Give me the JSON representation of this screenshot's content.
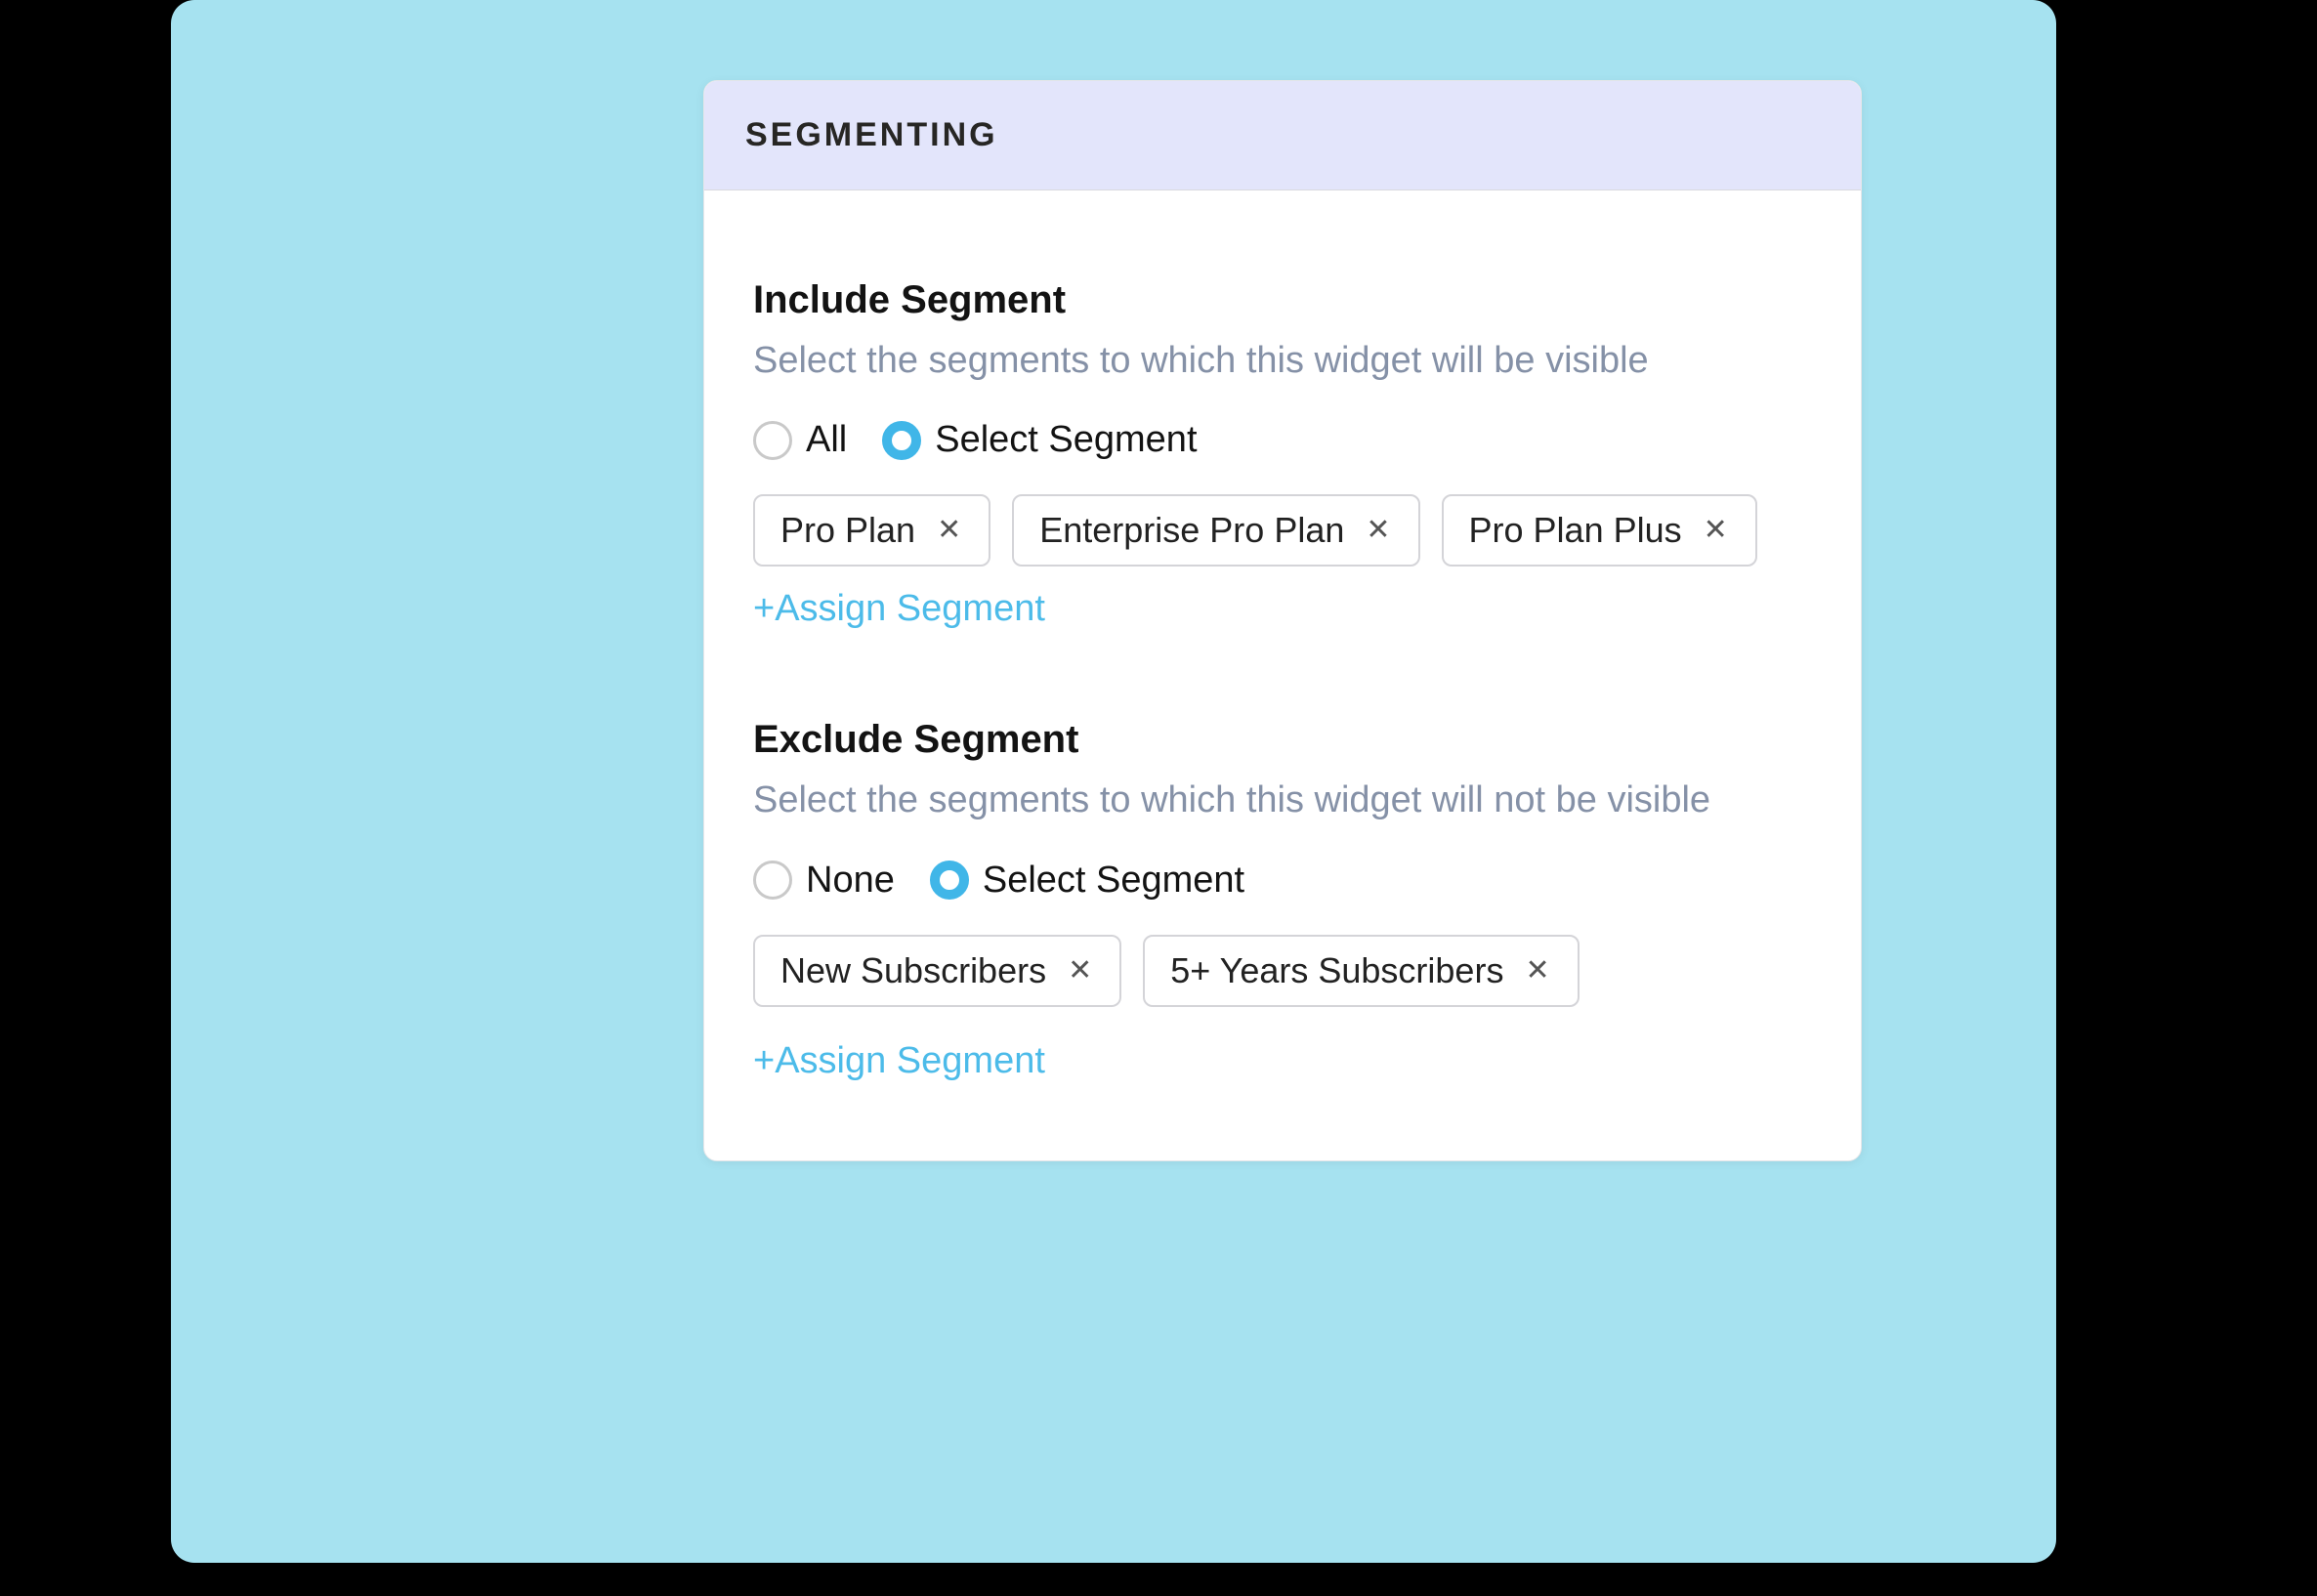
{
  "panel": {
    "title": "SEGMENTING"
  },
  "include": {
    "title": "Include Segment",
    "description": "Select the segments to which this widget will be visible",
    "radio_all_label": "All",
    "radio_select_label": "Select Segment",
    "chips": [
      {
        "label": "Pro Plan"
      },
      {
        "label": "Enterprise Pro Plan"
      },
      {
        "label": "Pro Plan Plus"
      }
    ],
    "assign_label": "+Assign Segment"
  },
  "exclude": {
    "title": "Exclude Segment",
    "description": "Select the segments to which this widget will not be visible",
    "radio_none_label": "None",
    "radio_select_label": "Select Segment",
    "chips": [
      {
        "label": "New Subscribers"
      },
      {
        "label": "5+ Years Subscribers"
      }
    ],
    "assign_label": "+Assign Segment"
  },
  "glyphs": {
    "close": "✕"
  }
}
